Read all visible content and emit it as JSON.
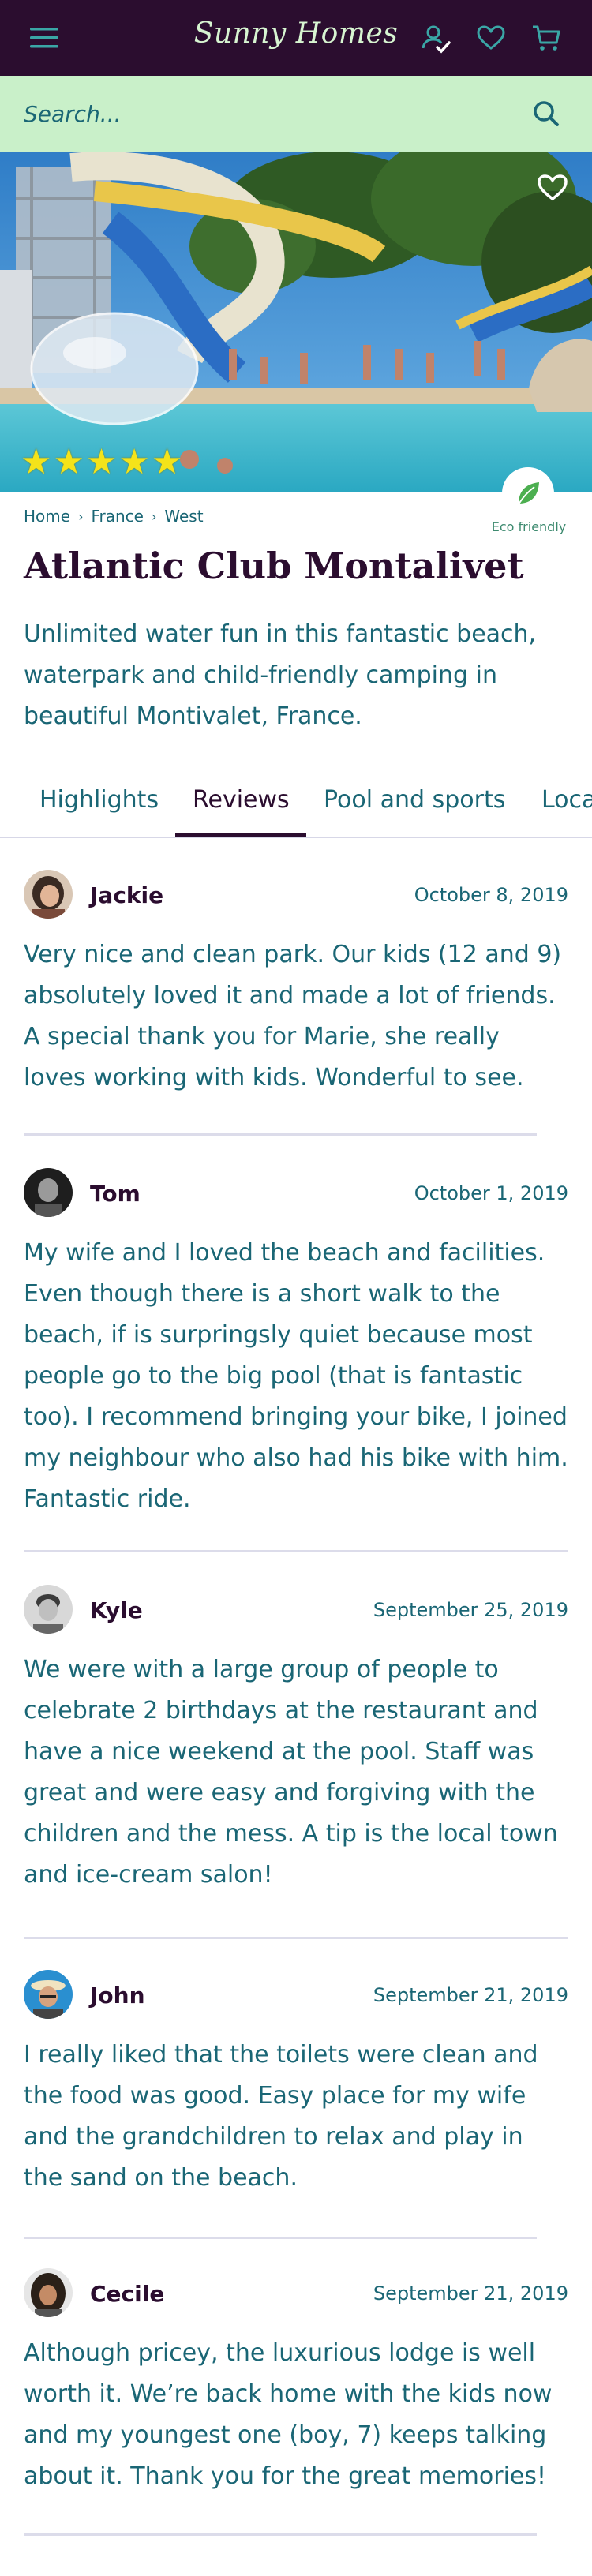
{
  "header": {
    "brand": "Sunny Homes",
    "menu_icon": "hamburger-menu-icon",
    "account_icon": "user-check-icon",
    "favorites_icon": "heart-icon",
    "cart_icon": "cart-icon",
    "bg_color": "#2b0d2f"
  },
  "search": {
    "placeholder": "Search...",
    "icon": "search-icon",
    "bg_color": "#c9f0c9"
  },
  "hero": {
    "rating": 5,
    "rating_max": 5,
    "favorite_icon": "heart-outline-icon",
    "eco_label": "Eco friendly",
    "eco_icon": "leaf-icon"
  },
  "breadcrumb": [
    "Home",
    "France",
    "West"
  ],
  "listing": {
    "title": "Atlantic Club Montalivet",
    "description": "Unlimited water fun in this fantastic beach, waterpark and child-friendly camping in beautiful Montivalet, France."
  },
  "tabs": [
    {
      "label": "Highlights",
      "active": false
    },
    {
      "label": "Reviews",
      "active": true
    },
    {
      "label": "Pool and sports",
      "active": false
    },
    {
      "label": "Loca",
      "active": false
    }
  ],
  "reviews": [
    {
      "name": "Jackie",
      "date": "October 8, 2019",
      "text": "Very nice and clean park. Our kids (12 and 9) absolutely loved it and made a lot of friends. A special thank you for Marie, she really loves working with kids. Wonderful to see."
    },
    {
      "name": "Tom",
      "date": "October 1, 2019",
      "text": "My wife and I loved the beach and facilities. Even though there is a short walk to the beach, if is surpringsly quiet because most people go to the big pool (that is fantastic too). I recommend bringing your bike, I joined my neighbour who also had his bike with him. Fantastic ride."
    },
    {
      "name": "Kyle",
      "date": "September 25, 2019",
      "text": "We were with a large group of people to celebrate 2 birthdays at the restaurant and have a nice weekend at the pool. Staff was great and were easy and forgiving with the children and the mess. A tip is the local town and ice-cream salon!"
    },
    {
      "name": "John",
      "date": "September 21, 2019",
      "text": "I really liked that the toilets were clean and the food was good. Easy place for my wife and the grandchildren to relax and play in the sand on the beach."
    },
    {
      "name": "Cecile",
      "date": "September 21, 2019",
      "text": "Although pricey, the luxurious lodge is well worth it. We’re back home with the kids now and my youngest one (boy, 7) keeps talking about it. Thank you for the great memories!"
    }
  ]
}
